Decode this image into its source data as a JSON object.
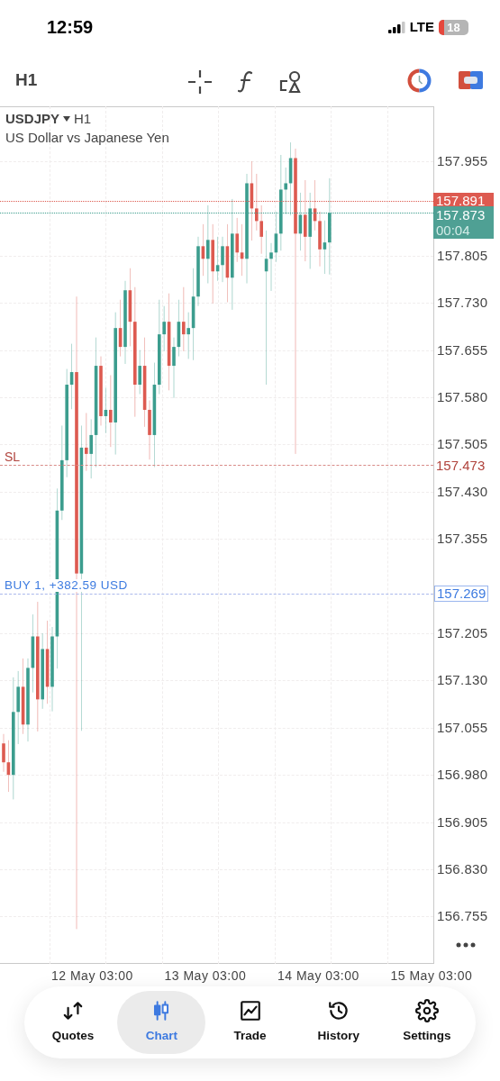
{
  "status_bar": {
    "time": "12:59",
    "network": "LTE",
    "battery": "18"
  },
  "toolbar": {
    "timeframe": "H1"
  },
  "chart": {
    "symbol": "USDJPY",
    "timeframe": "H1",
    "description": "US Dollar vs Japanese Yen",
    "price_axis": [
      "157.955",
      "157.805",
      "157.730",
      "157.655",
      "157.580",
      "157.505",
      "157.430",
      "157.355",
      "157.205",
      "157.130",
      "157.055",
      "156.980",
      "156.905",
      "156.830",
      "156.755"
    ],
    "price_lines": [
      {
        "kind": "ask",
        "price": "157.891"
      },
      {
        "kind": "bid",
        "price": "157.873",
        "timer": "00:04"
      },
      {
        "kind": "stop_loss",
        "tag": "SL",
        "price": "157.473"
      },
      {
        "kind": "position",
        "tag": "BUY 1, +382.59 USD",
        "price": "157.269"
      }
    ],
    "time_axis": [
      "12 May 03:00",
      "13 May 03:00",
      "14 May 03:00",
      "15 May 03:00"
    ]
  },
  "tabs": [
    {
      "kind": "quotes",
      "label": "Quotes",
      "selected": false
    },
    {
      "kind": "chart",
      "label": "Chart",
      "selected": true
    },
    {
      "kind": "trade",
      "label": "Trade",
      "selected": false
    },
    {
      "kind": "history",
      "label": "History",
      "selected": false
    },
    {
      "kind": "settings",
      "label": "Settings",
      "selected": false
    }
  ]
}
